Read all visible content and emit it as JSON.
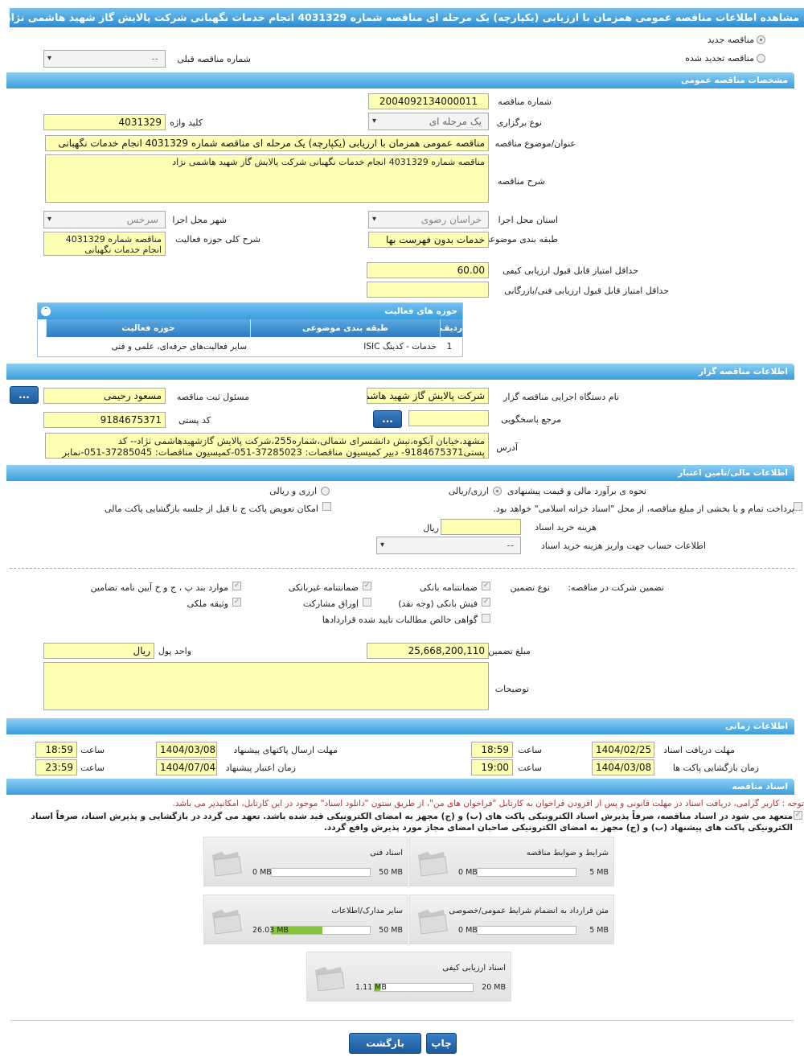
{
  "title": "مشاهده اطلاعات مناقصه عمومی همزمان با ارزیابی (یکپارچه) یک مرحله ای مناقصه شماره 4031329 انجام خدمات نگهبانی شرکت پالایش گاز شهید هاشمی نژاد",
  "top": {
    "new": "مناقصه جدید",
    "renewed": "مناقصه تجدید شده",
    "prev_label": "شماره مناقصه قبلی",
    "prev_value": "--"
  },
  "sections": {
    "general": "مشخصات مناقصه عمومی",
    "org": "اطلاعات مناقصه گزار",
    "finance": "اطلاعات مالی/تامین اعتبار",
    "time": "اطلاعات زمانی",
    "docs": "اسناد مناقصه"
  },
  "general": {
    "no_label": "شماره مناقصه",
    "no": "2004092134000011",
    "type_label": "نوع برگزاری",
    "type": "یک مرحله ای",
    "key_label": "کلید واژه",
    "key": "4031329",
    "subject_label": "عنوان/موضوع مناقصه",
    "subject": "مناقصه عمومی همزمان با ارزیابی (یکپارچه) یک مرحله ای مناقصه شماره 4031329 انجام خدمات نگهبانی",
    "desc_label": "شرح مناقصه",
    "desc": "مناقصه شماره 4031329 انجام خدمات نگهبانی شرکت پالایش گاز شهید هاشمی نژاد",
    "province_label": "استان محل اجرا",
    "province": "خراسان رضوی",
    "city_label": "شهر محل اجرا",
    "city": "سرخس",
    "category_label": "طبقه بندی موضوعی",
    "category": "خدمات بدون فهرست بها",
    "scope_label": "شرح کلی حوزه فعالیت",
    "scope": "مناقصه شماره 4031329 انجام خدمات نگهبانی",
    "quality_label": "حداقل امتیاز قابل قبول ارزیابی کیفی",
    "quality": "60.00",
    "tech_label": "حداقل امتیاز قابل قبول ارزیابی فنی/بازرگانی",
    "tech": ""
  },
  "activity": {
    "title": "حوزه های فعالیت",
    "h_row": "ردیف",
    "h_cat": "طبقه بندی موضوعی",
    "h_field": "حوزه فعالیت",
    "rows": [
      {
        "n": "1",
        "cat": "خدمات - کدینگ ISIC",
        "field": "سایر فعالیت‌های حرفه‌ای، علمی و فنی"
      }
    ]
  },
  "org": {
    "name_label": "نام دستگاه اجرایی مناقصه گزار",
    "name": "شرکت پالایش گاز شهید هاشمی نژاد",
    "resp_label": "مسئول ثبت مناقصه",
    "resp": "مسعود رحیمی",
    "ref_label": "مرجع پاسخگویی",
    "ref": "",
    "postal_label": "کد پستی",
    "postal": "9184675371",
    "addr_label": "آدرس",
    "addr": "مشهد،خیابان آبکوه،نبش دانشسرای شمالی،شماره255،شرکت پالایش گازشهیدهاشمی نژاد-- کد پستی9184675371- دبیر کمیسیون مناقصات: 37285023-051-کمیسیون مناقصات: 37285045-051-نمابر",
    "btn": "..."
  },
  "finance": {
    "est_label": "نحوه ی برآورد مالی و قیمت پیشنهادی",
    "opt1": "ارزی/ریالی",
    "opt2": "ارزی و ریالی",
    "treasury": "پرداخت تمام و یا بخشی از مبلغ مناقصه، از محل \"اسناد خزانه اسلامی\" خواهد بود.",
    "swap": "امکان تعویض پاکت ج تا قبل از جلسه بازگشایی پاکت مالی",
    "cost_label": "هزینه خرید اسناد",
    "cost": "",
    "currency": "ریال",
    "acct_label": "اطلاعات حساب جهت واریز هزینه خرید اسناد",
    "acct": "--",
    "guar_label": "تضمین شرکت در مناقصه:",
    "gtype_label": "نوع تضمین",
    "g1": "ضمانتنامه بانکی",
    "g2": "ضمانتنامه غیربانکی",
    "g3": "موارد بند پ ، ج و خ آیین نامه تضامین",
    "g4": "فیش بانکی (وجه نقد)",
    "g5": "اوراق مشارکت",
    "g6": "وثیقه ملکی",
    "g7": "گواهی خالص مطالبات تایید شده قراردادها",
    "amount_label": "مبلغ تضمین",
    "amount": "25,668,200,110",
    "unit_label": "واحد پول",
    "unit": "ریال",
    "notes_label": "توضیحات",
    "notes": ""
  },
  "time": {
    "recv_label": "مهلت دریافت اسناد",
    "recv": "1404/02/25",
    "recv_t": "18:59",
    "send_label": "مهلت ارسال پاکتهای پیشنهاد",
    "send": "1404/03/08",
    "send_t": "18:59",
    "open_label": "زمان بازگشایی پاکت ها",
    "open": "1404/03/08",
    "open_t": "19:00",
    "valid_label": "زمان اعتبار پیشنهاد",
    "valid": "1404/07/04",
    "valid_t": "23:59",
    "time_label": "ساعت"
  },
  "docs": {
    "note": "توجه : کاربر گرامی، دریافت اسناد در مهلت قانونی و پس از افزودن فراخوان به کارتابل \"فراخوان های من\"، از طریق ستون \"دانلود اسناد\" موجود در این کارتابل، امکانپذیر می باشد.",
    "commit": "متعهد می شود در اسناد مناقصه، صرفاً پذیرش اسناد الکترونیکی پاکت های (ب) و (ج) مجهز به امضای الکترونیکی قید شده باشد. تعهد می گردد در بازگشایی و پذیرش اسناد، صرفاً اسناد الکترونیکی پاکت های پیشنهاد (ب) و (ج) مجهز به امضای الکترونیکی صاحبان امضای مجاز مورد پذیرش واقع گردد.",
    "files": [
      {
        "title": "شرایط و ضوابط مناقصه",
        "max": "5 MB",
        "cur": "0 MB",
        "fill": 0
      },
      {
        "title": "اسناد فنی",
        "max": "50 MB",
        "cur": "0 MB",
        "fill": 0
      },
      {
        "title": "متن قرارداد به انضمام شرایط عمومی/خصوصی",
        "max": "5 MB",
        "cur": "0 MB",
        "fill": 0
      },
      {
        "title": "سایر مدارک/اطلاعات",
        "max": "50 MB",
        "cur": "26.03 MB",
        "fill": 0.52
      },
      {
        "title": "اسناد ارزیابی کیفی",
        "max": "20 MB",
        "cur": "1.11 MB",
        "fill": 0.06
      }
    ]
  },
  "buttons": {
    "print": "چاپ",
    "back": "بازگشت"
  }
}
